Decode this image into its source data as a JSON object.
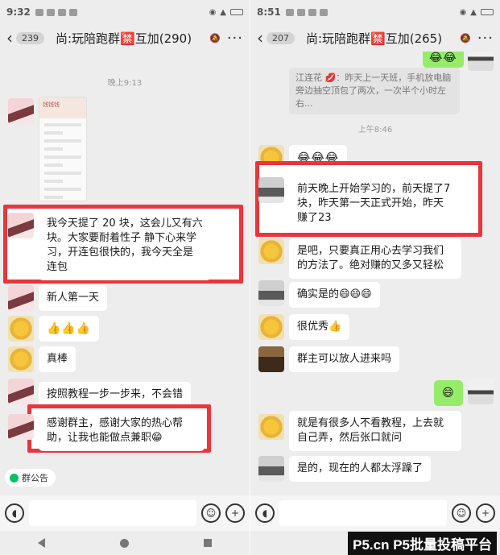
{
  "left": {
    "status_time": "9:32",
    "back_count": "239",
    "group_title": "尚:玩陪跑群🈲互加(290)",
    "more": "···",
    "timestamp": "晚上9:13",
    "screenshot_caption": "钱钱钱",
    "messages": {
      "m1": "我今天提了 20 块，这会儿又有六块。大家要耐着性子 静下心来学习，开连包很快的，我今天全是连包",
      "m2": "新人第一天",
      "m3": "👍👍👍",
      "m4": "真棒",
      "m5": "按照教程一步一步来，不会错",
      "m6": "感谢群主，感谢大家的热心帮助，让我也能做点兼职😁"
    },
    "notice": "群公告"
  },
  "right": {
    "status_time": "8:51",
    "back_count": "207",
    "group_title": "尚:玩陪跑群🈲互加(265)",
    "more": "···",
    "quote": "江连花 💋：昨天上一天班，手机放电脑旁边抽空顶包了两次，一次半个小时左右...",
    "timestamp": "上午8:46",
    "messages": {
      "m0": "😂😂",
      "m1": "😂😂😂",
      "m2": "前天晚上开始学习的，前天提了7块，昨天第一天正式开始，昨天赚了23",
      "m3": "是吧，只要真正用心去学习我们的方法了。绝对赚的又多又轻松",
      "m4": "确实是的😄😄😄",
      "m5": "很优秀👍",
      "m6": "群主可以放人进来吗",
      "m7": "😄",
      "m8": "就是有很多人不看教程，上去就自己弄，然后张口就问",
      "m9": "是的，现在的人都太浮躁了"
    }
  },
  "watermark": "P5.cn P5批量投稿平台",
  "colors": {
    "highlight": "#e8363a",
    "bubble_green": "#95ec69",
    "chat_bg": "#ededed"
  }
}
